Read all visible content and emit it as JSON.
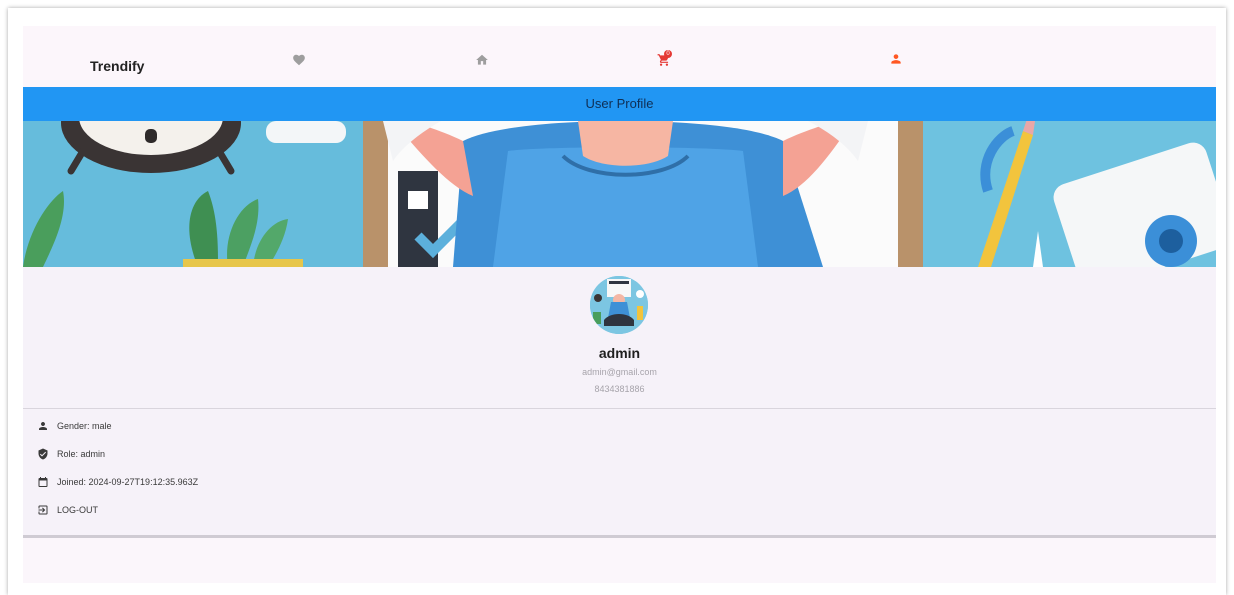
{
  "navbar": {
    "brand": "Trendify",
    "icons": [
      "heart-icon",
      "home-icon",
      "cart-icon",
      "person-icon"
    ],
    "cart_badge": "0",
    "active_color": "#ff5722",
    "inactive_color": "#9e9e9e"
  },
  "header": {
    "title": "User Profile",
    "bar_color": "#2196f3"
  },
  "profile": {
    "username": "admin",
    "email": "admin@gmail.com",
    "phone": "8434381886"
  },
  "details": {
    "gender": "Gender: male",
    "role": "Role: admin",
    "joined": "Joined: 2024-09-27T19:12:35.963Z",
    "logout": "LOG-OUT"
  }
}
